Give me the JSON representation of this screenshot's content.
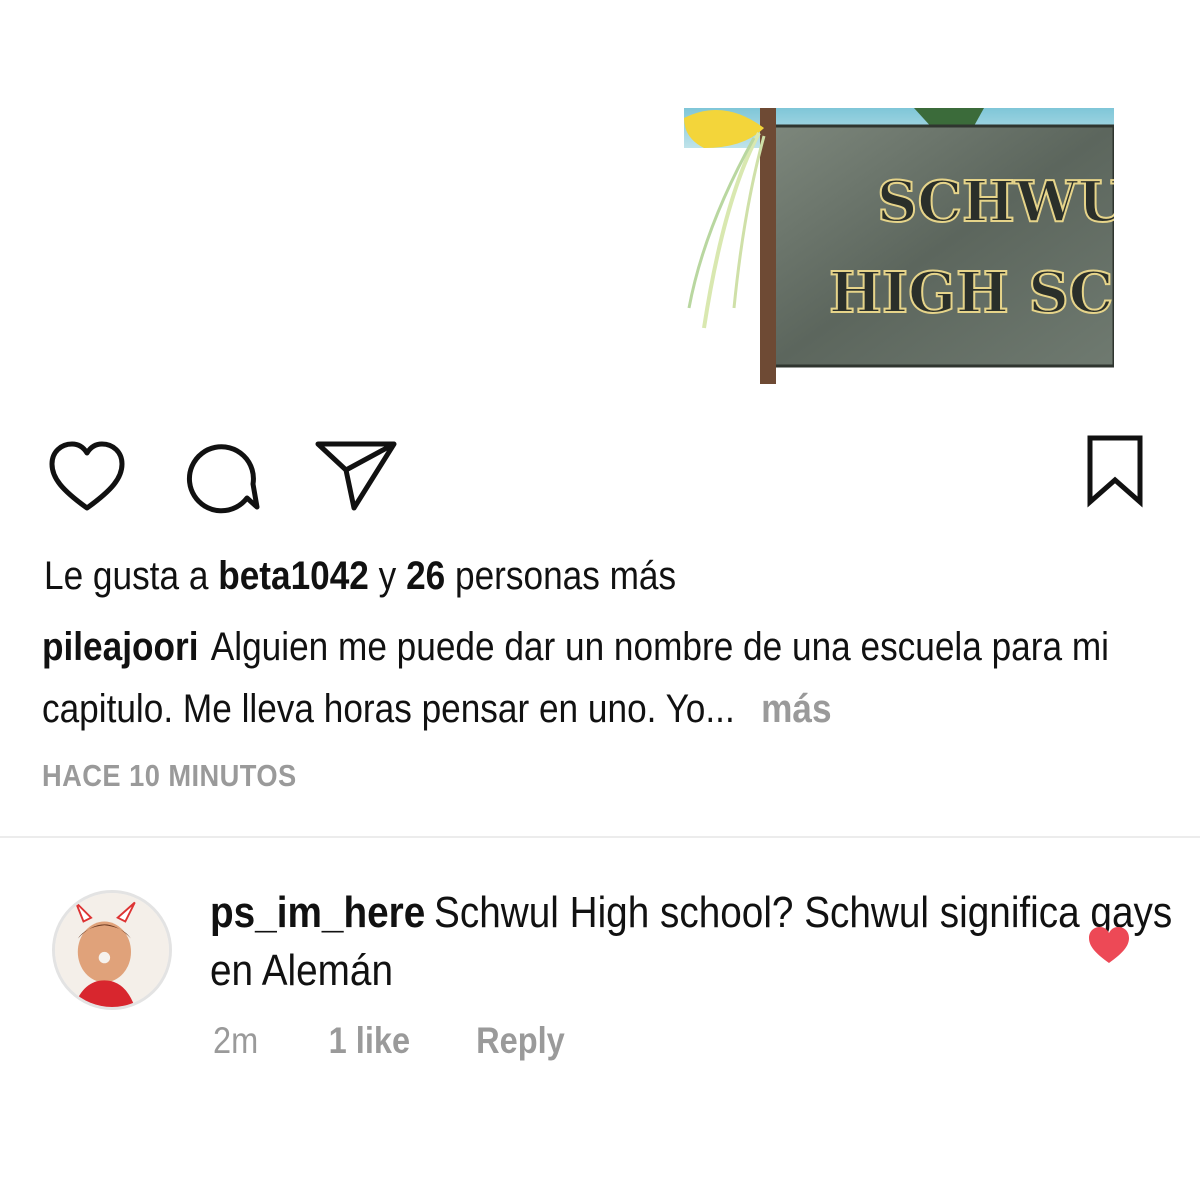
{
  "post": {
    "image": {
      "sign_line1": "SCHWUL",
      "sign_line2": "HIGH SCHOO",
      "ribbon_color": "#f3d53a",
      "sign_color": "#6a746a"
    },
    "likes": {
      "prefix": "Le gusta a",
      "user": "beta1042",
      "middle": "y",
      "count": "26",
      "suffix": "personas más"
    },
    "caption": {
      "username": "pileajoori",
      "text": "Alguien me puede dar un nombre de una escuela para mi capitulo. Me lleva horas pensar en uno. Yo...",
      "more": "más"
    },
    "timestamp": "HACE 10 MINUTOS"
  },
  "actions": {
    "like": "heart-icon",
    "comment": "comment-icon",
    "share": "send-icon",
    "save": "bookmark-icon"
  },
  "comment": {
    "username": "ps_im_here",
    "text": "Schwul High school? Schwul significa gays en Alemán",
    "time": "2m",
    "likes": "1 like",
    "reply": "Reply",
    "heart_color": "#ed4956"
  }
}
